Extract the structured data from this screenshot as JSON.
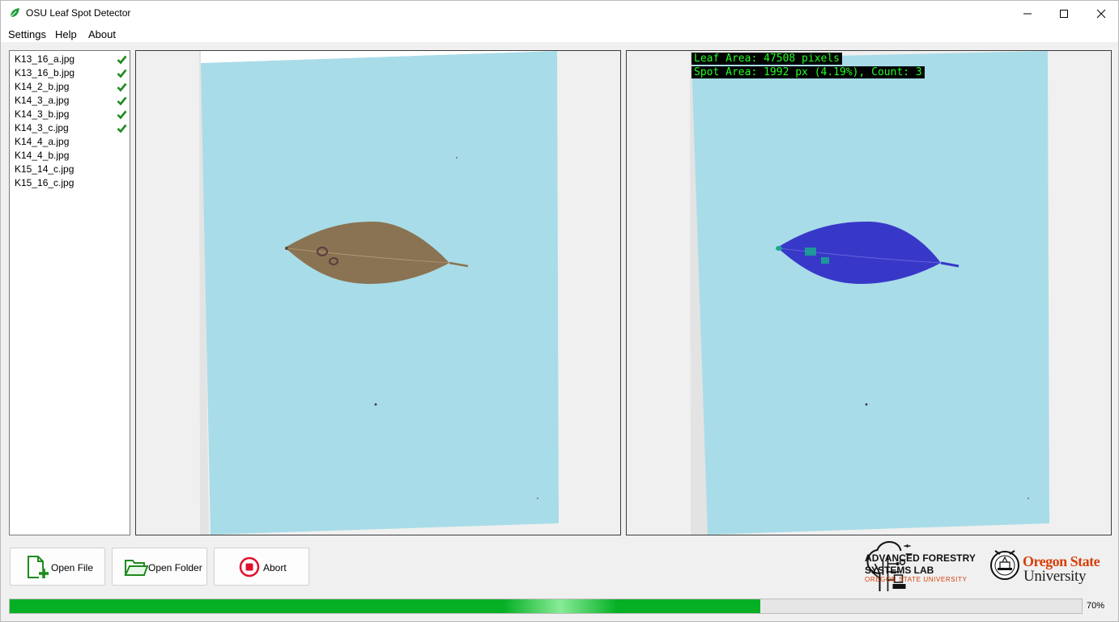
{
  "window": {
    "title": "OSU Leaf Spot Detector"
  },
  "menu": [
    "Settings",
    "Help",
    "About"
  ],
  "files": [
    {
      "name": "K13_16_a.jpg",
      "done": true
    },
    {
      "name": "K13_16_b.jpg",
      "done": true
    },
    {
      "name": "K14_2_b.jpg",
      "done": true
    },
    {
      "name": "K14_3_a.jpg",
      "done": true
    },
    {
      "name": "K14_3_b.jpg",
      "done": true
    },
    {
      "name": "K14_3_c.jpg",
      "done": true
    },
    {
      "name": "K14_4_a.jpg",
      "done": false
    },
    {
      "name": "K14_4_b.jpg",
      "done": false
    },
    {
      "name": "K15_14_c.jpg",
      "done": false
    },
    {
      "name": "K15_16_c.jpg",
      "done": false
    }
  ],
  "result": {
    "leaf_area": "Leaf Area: 47508 pixels",
    "spot_area": "Spot Area: 1992 px (4.19%), Count: 3"
  },
  "buttons": {
    "open_file": "Open File",
    "open_folder": "Open Folder",
    "abort": "Abort"
  },
  "logos": {
    "afsl_line1": "ADVANCED FORESTRY",
    "afsl_line2": "SYSTEMS LAB",
    "afsl_sub": "OREGON STATE UNIVERSITY",
    "osu_line1": "Oregon State",
    "osu_line2": "University"
  },
  "progress": {
    "value": 0.7,
    "label": "70%"
  },
  "colors": {
    "paper": "#a8dce8",
    "leaf": "#8a7352",
    "leaf_mask": "#3838c8",
    "spot_mask": "#1aa890",
    "overlay_text": "#22ff22",
    "progress": "#06b025",
    "check": "#1f8a1f",
    "osu_orange": "#d73f09"
  }
}
